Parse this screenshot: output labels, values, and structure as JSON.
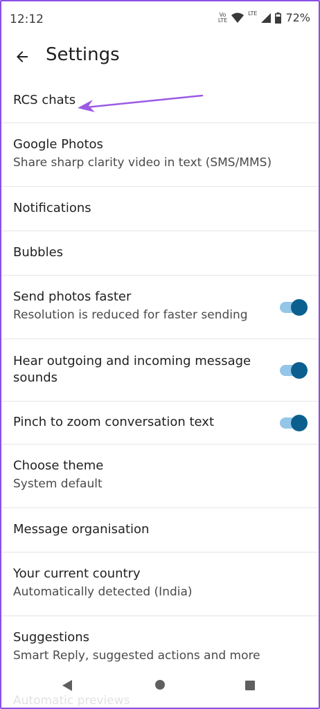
{
  "status_bar": {
    "time": "12:12",
    "sim_label_top": "Vo",
    "sim_label_bottom": "LTE",
    "lte_label": "LTE",
    "battery": "72%"
  },
  "app_bar": {
    "title": "Settings"
  },
  "settings": [
    {
      "title": "RCS chats",
      "subtitle": "",
      "has_toggle": false
    },
    {
      "title": "Google Photos",
      "subtitle": "Share sharp clarity video in text (SMS/MMS)",
      "has_toggle": false
    },
    {
      "title": "Notifications",
      "subtitle": "",
      "has_toggle": false
    },
    {
      "title": "Bubbles",
      "subtitle": "",
      "has_toggle": false
    },
    {
      "title": "Send photos faster",
      "subtitle": "Resolution is reduced for faster sending",
      "has_toggle": true,
      "toggle_on": true
    },
    {
      "title": "Hear outgoing and incoming message sounds",
      "subtitle": "",
      "has_toggle": true,
      "toggle_on": true
    },
    {
      "title": "Pinch to zoom conversation text",
      "subtitle": "",
      "has_toggle": true,
      "toggle_on": true
    },
    {
      "title": "Choose theme",
      "subtitle": "System default",
      "has_toggle": false
    },
    {
      "title": "Message organisation",
      "subtitle": "",
      "has_toggle": false
    },
    {
      "title": "Your current country",
      "subtitle": "Automatically detected (India)",
      "has_toggle": false
    },
    {
      "title": "Suggestions",
      "subtitle": "Smart Reply, suggested actions and more",
      "has_toggle": false
    }
  ],
  "partially_hidden_item": "Automatic previews",
  "colors": {
    "accent": "#0b5f8e",
    "track": "#93c6e8",
    "annotation": "#9b59e6",
    "frame": "#8a4fe6"
  },
  "icons": [
    "back-arrow-icon",
    "wifi-icon",
    "signal-icon",
    "battery-icon",
    "nav-back-icon",
    "nav-home-icon",
    "nav-recents-icon"
  ]
}
